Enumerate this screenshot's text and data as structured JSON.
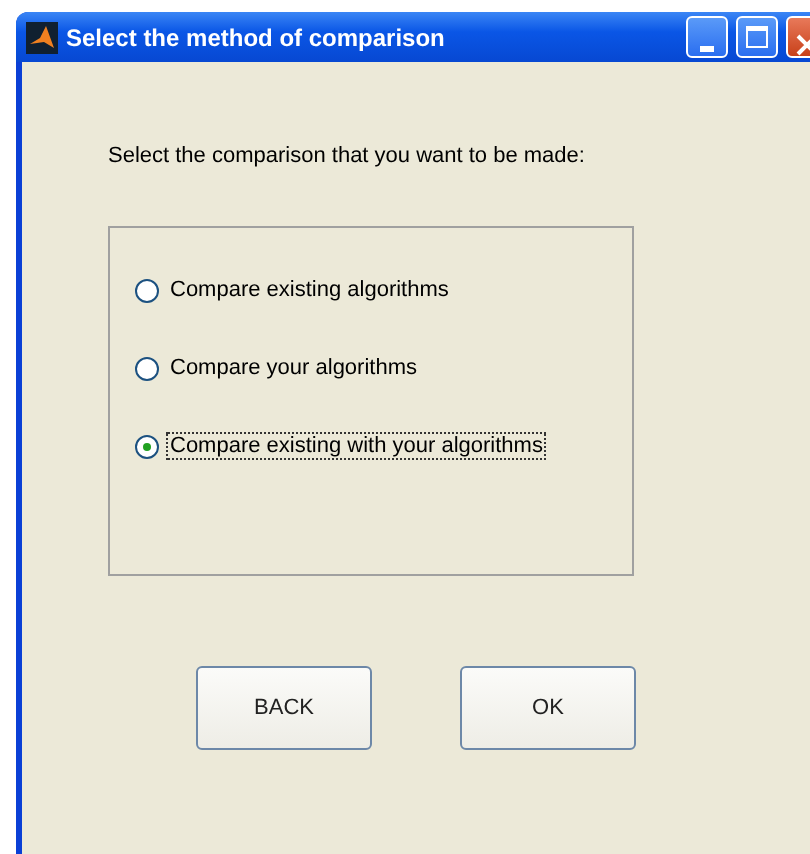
{
  "window": {
    "title": "Select the method of comparison"
  },
  "prompt": "Select the comparison that you want to be made:",
  "options": [
    {
      "label": "Compare existing algorithms",
      "selected": false
    },
    {
      "label": "Compare your algorithms",
      "selected": false
    },
    {
      "label": "Compare existing with your algorithms",
      "selected": true
    }
  ],
  "buttons": [
    "BACK",
    "OK"
  ]
}
